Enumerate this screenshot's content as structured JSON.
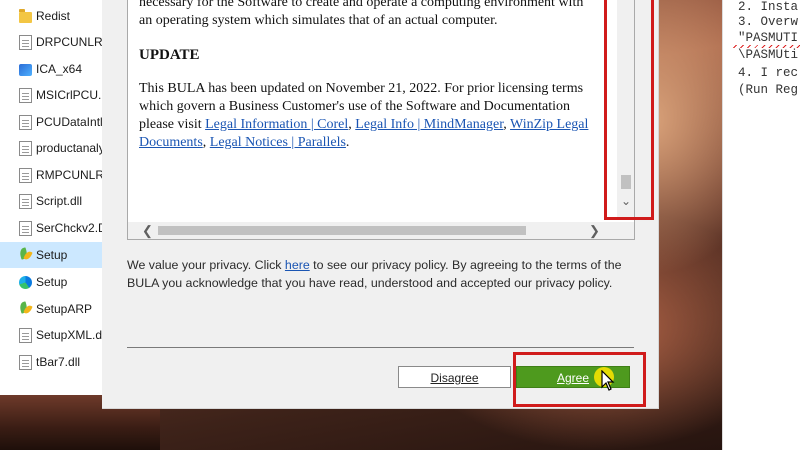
{
  "files": [
    {
      "name": "Redist",
      "icon": "folder-icon",
      "selected": false
    },
    {
      "name": "DRPCUNLR.d",
      "icon": "dll-file-icon",
      "selected": false
    },
    {
      "name": "ICA_x64",
      "icon": "app-icon",
      "selected": false
    },
    {
      "name": "MSICrlPCU.D",
      "icon": "dll-file-icon",
      "selected": false
    },
    {
      "name": "PCUDataIntl.",
      "icon": "dll-file-icon",
      "selected": false
    },
    {
      "name": "productanaly",
      "icon": "dll-file-icon",
      "selected": false
    },
    {
      "name": "RMPCUNLR.d",
      "icon": "dll-file-icon",
      "selected": false
    },
    {
      "name": "Script.dll",
      "icon": "dll-file-icon",
      "selected": false
    },
    {
      "name": "SerChckv2.D",
      "icon": "dll-file-icon",
      "selected": false
    },
    {
      "name": "Setup",
      "icon": "setup-leaf-icon",
      "selected": true
    },
    {
      "name": "Setup",
      "icon": "edge-icon",
      "selected": false
    },
    {
      "name": "SetupARP",
      "icon": "setup-leaf-icon",
      "selected": false
    },
    {
      "name": "SetupXML.dl",
      "icon": "dll-file-icon",
      "selected": false
    },
    {
      "name": "tBar7.dll",
      "icon": "dll-file-icon",
      "selected": false
    }
  ],
  "license": {
    "intro_text": "necessary for the Software to create and operate a computing environment with an operating system which simulates that of an actual computer.",
    "update_heading": "UPDATE",
    "update_text": "This BULA has been updated on November 21, 2022. For prior licensing terms which govern a Business Customer's use of the Software and Documentation please visit",
    "links": [
      "Legal Information | Corel",
      "Legal Info | MindManager",
      "WinZip Legal Documents",
      "Legal Notices | Parallels"
    ],
    "scroll_position": 0.95
  },
  "privacy": {
    "before_link": "We value your privacy. Click ",
    "link": "here",
    "after_link": " to see our privacy policy. By agreeing to the terms of the BULA you acknowledge that you have read, understood and accepted our privacy policy."
  },
  "buttons": {
    "disagree_label": "Disagree",
    "agree_label": "Agree"
  },
  "notepad": {
    "lines": [
      "2. Insta",
      "3. Overw",
      "\"PASMUTI",
      "\\PASMUti",
      "4. I rec",
      "(Run Reg"
    ]
  },
  "colors": {
    "agree_button": "#4e9a1e",
    "highlight": "#d01b1b",
    "link": "#1a55b3"
  }
}
